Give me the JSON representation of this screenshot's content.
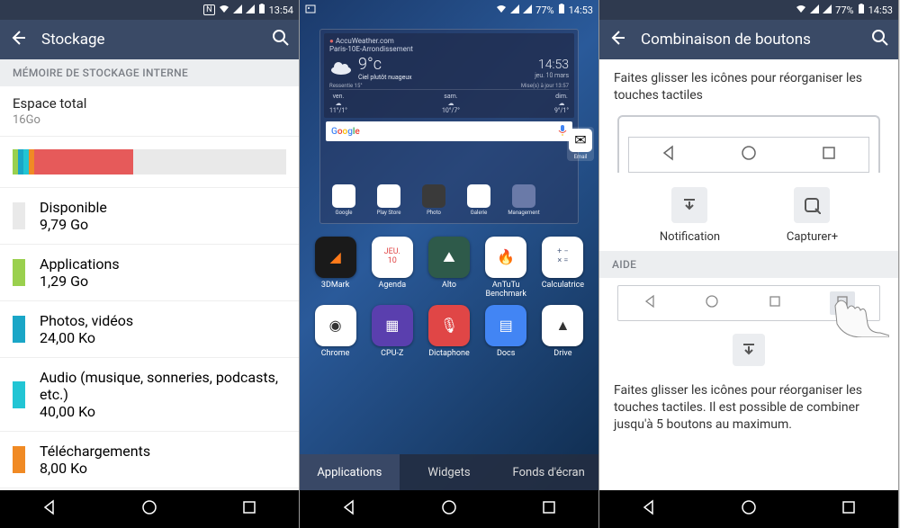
{
  "p1": {
    "status": {
      "icons": [
        "N",
        "wifi",
        "signal",
        "signal"
      ],
      "time": "13:54"
    },
    "appbar": {
      "title": "Stockage"
    },
    "section": "MÉMOIRE DE STOCKAGE INTERNE",
    "total": {
      "label": "Espace total",
      "value": "16Go"
    },
    "segments": [
      {
        "color": "#9ad04e",
        "pct": 2
      },
      {
        "color": "#1aa6c7",
        "pct": 2
      },
      {
        "color": "#22c5d4",
        "pct": 2
      },
      {
        "color": "#f08a24",
        "pct": 2
      },
      {
        "color": "#e65a5a",
        "pct": 36
      }
    ],
    "items": [
      {
        "color": "#e9e9e9",
        "label": "Disponible",
        "value": "9,79 Go"
      },
      {
        "color": "#9ad04e",
        "label": "Applications",
        "value": "1,29 Go"
      },
      {
        "color": "#1aa6c7",
        "label": "Photos, vidéos",
        "value": "24,00 Ko"
      },
      {
        "color": "#22c5d4",
        "label": "Audio (musique, sonneries, podcasts, etc.)",
        "value": "40,00 Ko"
      },
      {
        "color": "#f08a24",
        "label": "Téléchargements",
        "value": "8,00 Ko"
      }
    ]
  },
  "p2": {
    "status": {
      "left": "gallery-icon",
      "battery": "77%",
      "time": "14:53"
    },
    "weather": {
      "provider": "AccuWeather.com",
      "location": "Paris-10E-Arrondissement",
      "feels": "Ressentie 15°",
      "temp": "9°c",
      "cond": "Ciel plutôt nuageux",
      "clock": "14:53",
      "date": "jeu. 10 mars",
      "updated": "Mise(s) à jour 13:57",
      "forecast": [
        {
          "day": "ven.",
          "hi": "11°",
          "lo": "1°"
        },
        {
          "day": "sam.",
          "hi": "10°",
          "lo": "7°"
        },
        {
          "day": "dim.",
          "hi": "9°",
          "lo": "1°"
        }
      ]
    },
    "search": {
      "placeholder": "Google"
    },
    "preview_apps": [
      {
        "label": "Google",
        "bg": "#fff"
      },
      {
        "label": "Play Store",
        "bg": "#fff"
      },
      {
        "label": "Photo",
        "bg": "#3a3a3a"
      },
      {
        "label": "Galerie",
        "bg": "#fff"
      },
      {
        "label": "Management",
        "bg": "#6a7aa8"
      }
    ],
    "side_app": "Email",
    "drawer": [
      {
        "label": "3DMark",
        "bg": "#1a1a1a",
        "fg": "#ff7a1a",
        "glyph": "◢"
      },
      {
        "label": "Agenda",
        "bg": "#fff",
        "fg": "#e04646",
        "glyph": "JEU.\n10"
      },
      {
        "label": "Alto",
        "bg": "#2e5a4a",
        "fg": "#fff",
        "glyph": "⛰"
      },
      {
        "label": "AnTuTu Benchmark",
        "bg": "#fff",
        "fg": "#d63f3f",
        "glyph": "🔥"
      },
      {
        "label": "Calculatrice",
        "bg": "#fff",
        "fg": "#5a6a8a",
        "glyph": "+ −\n× ="
      },
      {
        "label": "Chrome",
        "bg": "#fff",
        "fg": "#333",
        "glyph": "◉"
      },
      {
        "label": "CPU-Z",
        "bg": "#5a3fae",
        "fg": "#fff",
        "glyph": "▦"
      },
      {
        "label": "Dictaphone",
        "bg": "#e04646",
        "fg": "#fff",
        "glyph": "🎙"
      },
      {
        "label": "Docs",
        "bg": "#4285F4",
        "fg": "#fff",
        "glyph": "▤"
      },
      {
        "label": "Drive",
        "bg": "#fff",
        "fg": "#333",
        "glyph": "▲"
      }
    ],
    "tabs": [
      {
        "label": "Applications",
        "active": true
      },
      {
        "label": "Widgets",
        "active": false
      },
      {
        "label": "Fonds d'écran",
        "active": false
      }
    ]
  },
  "p3": {
    "status": {
      "battery": "77%",
      "time": "14:53"
    },
    "appbar": {
      "title": "Combinaison de boutons"
    },
    "instr1": "Faites glisser les icônes pour réorganiser les touches tactiles",
    "options": [
      {
        "icon": "notification-tray-icon",
        "label": "Notification"
      },
      {
        "icon": "capture-plus-icon",
        "label": "Capturer+"
      }
    ],
    "help_header": "AIDE",
    "extra_icon": "notification-tray-icon",
    "instr2": "Faites glisser les icônes pour réorganiser les touches tactiles. Il est possible de combiner jusqu'à 5 boutons au maximum."
  }
}
